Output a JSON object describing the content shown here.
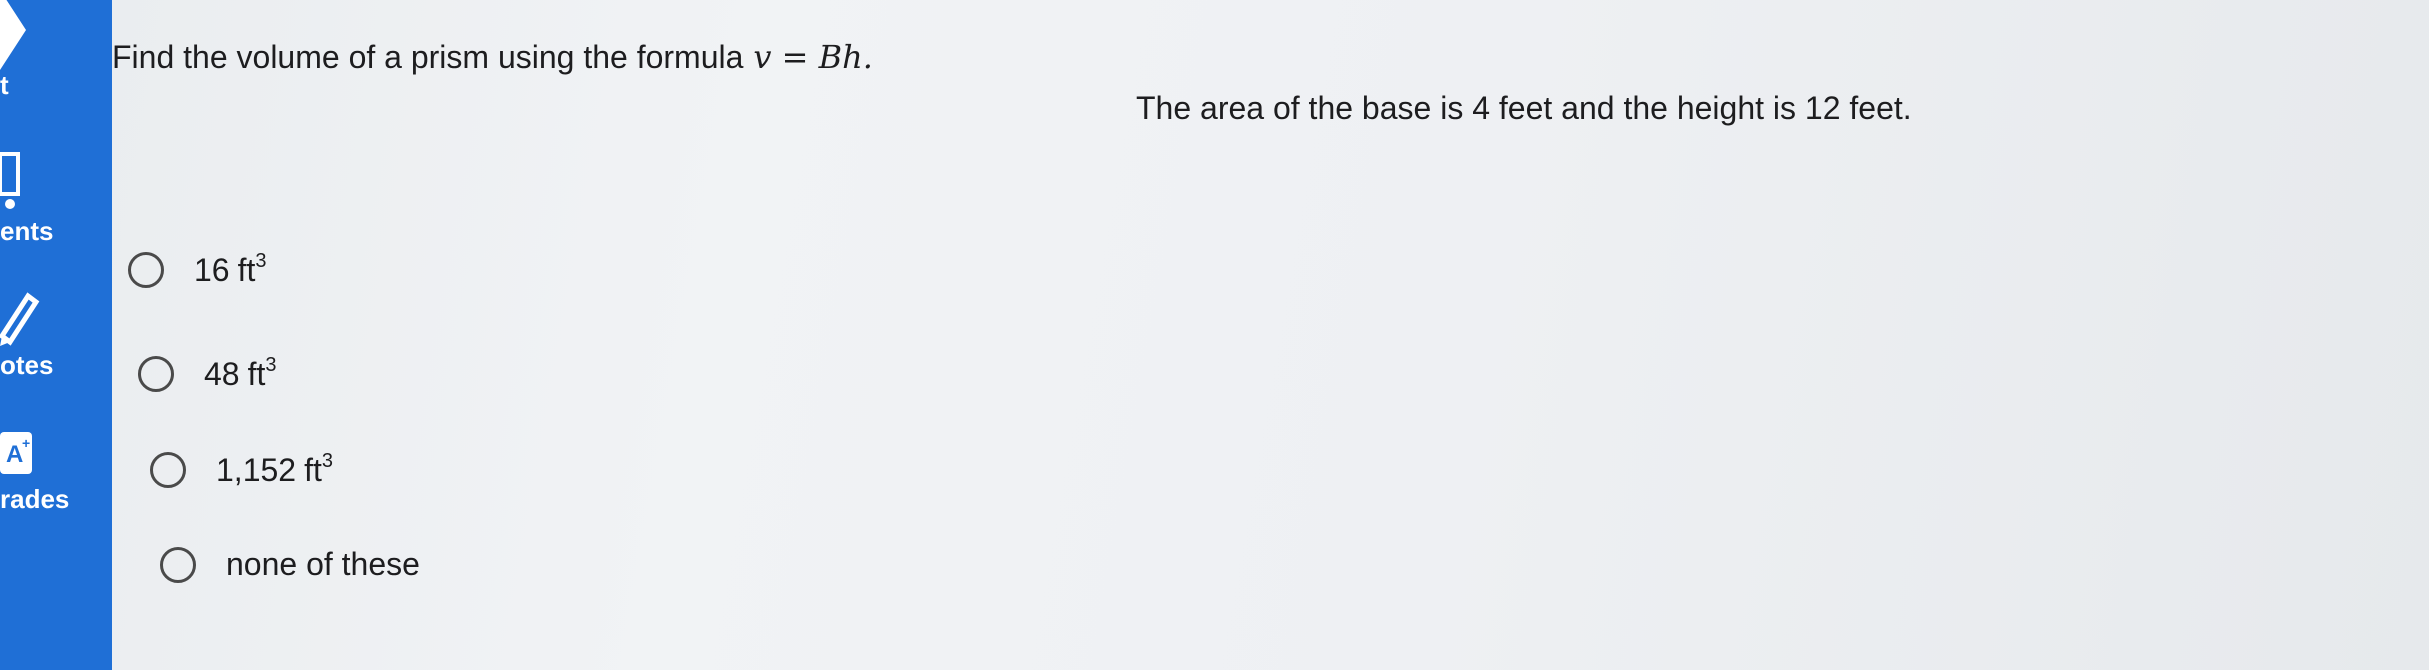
{
  "sidebar": {
    "items": [
      {
        "label": "t",
        "icon": "arrow-right-icon"
      },
      {
        "label": "ents",
        "icon": "info-icon"
      },
      {
        "label": "otes",
        "icon": "pencil-icon"
      },
      {
        "label": "rades",
        "icon": "grades-icon"
      }
    ],
    "color": "#1f6fd6"
  },
  "question": {
    "text": "Find the volume of a prism using the formula",
    "formula": "v = Bh.",
    "given": "The area of the base is 4 feet and the height is 12 feet."
  },
  "options": [
    {
      "value": "16",
      "unit": "ft",
      "exponent": "3"
    },
    {
      "value": "48",
      "unit": "ft",
      "exponent": "3"
    },
    {
      "value": "1,152",
      "unit": "ft",
      "exponent": "3"
    },
    {
      "value": "none of these",
      "unit": "",
      "exponent": ""
    }
  ]
}
